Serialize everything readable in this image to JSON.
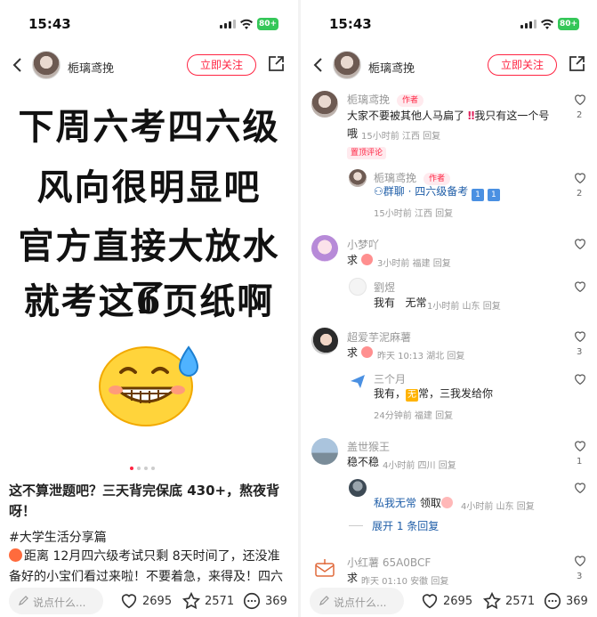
{
  "status": {
    "time": "15:43",
    "battery": "80+"
  },
  "header": {
    "username": "栀璃鸢挽",
    "follow_label": "立即关注"
  },
  "poster": {
    "lines": [
      "下周六考四六级",
      "风向很明显吧",
      "官方直接大放水了",
      "就考这6页纸啊"
    ]
  },
  "post": {
    "title": "这不算泄题吧？三天背完保底 430+，熬夜背呀！",
    "tag": "#大学生活分享篇",
    "body": "距离 12月四六级考试只剩 8天时间了，还没准备好的小宝们看过来啦！不要着急，来得及！四六级"
  },
  "bottombar": {
    "placeholder": "说点什么...",
    "likes": "2695",
    "stars": "2571",
    "comments": "369"
  },
  "comments": {
    "c1": {
      "name": "栀璃鸢挽",
      "badge": "作者",
      "text_a": "大家不要被其他人马扁了",
      "text_b": "我只有这一个号",
      "text_c": "哦",
      "meta": "15小时前 江西 回复",
      "pinned": "置顶评论",
      "likes": "2"
    },
    "c1r": {
      "name": "栀璃鸢挽",
      "badge": "作者",
      "link": "群聊 · 四六级备考",
      "keys": [
        "1",
        "1"
      ],
      "meta": "15小时前 江西 回复",
      "likes": "2"
    },
    "c2": {
      "name": "小梦吖",
      "text": "求",
      "meta": "3小时前 福建 回复"
    },
    "c2r": {
      "name": "劉煜",
      "text": "我有   无常",
      "meta": "1小时前 山东 回复"
    },
    "c3": {
      "name": "超爱芋泥麻薯",
      "text": "求",
      "meta": "昨天 10:13 湖北 回复",
      "likes": "3"
    },
    "c3r": {
      "name": "三个月",
      "text_a": "我有，",
      "text_b": "常，三我发给你",
      "emoji_text": "无",
      "meta": "24分钟前 福建 回复"
    },
    "c4": {
      "name": "盖世猴王",
      "text": "稳不稳",
      "meta": "4小时前 四川 回复",
      "likes": "1"
    },
    "c4r": {
      "text_a": "私我无常",
      "text_b": "领取",
      "meta": "4小时前 山东 回复"
    },
    "expand": "展开 1 条回复",
    "c5": {
      "name": "小红薯 65A0BCF",
      "text": "求",
      "meta": "昨天 01:10 安徽 回复",
      "likes": "3"
    }
  },
  "colors": {
    "accent": "#ff2442",
    "link": "#1f5ea8"
  }
}
